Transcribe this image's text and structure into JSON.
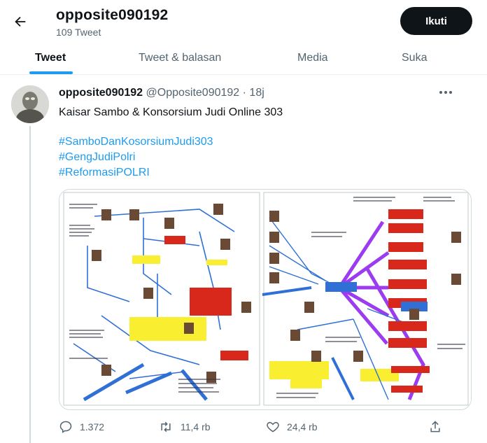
{
  "header": {
    "profile_name": "opposite090192",
    "tweet_count": "109 Tweet",
    "follow_label": "Ikuti"
  },
  "tabs": [
    {
      "label": "Tweet",
      "active": true
    },
    {
      "label": "Tweet & balasan",
      "active": false
    },
    {
      "label": "Media",
      "active": false
    },
    {
      "label": "Suka",
      "active": false
    }
  ],
  "tweet": {
    "author_name": "opposite090192",
    "author_handle": "@Opposite090192",
    "separator": "·",
    "time": "18j",
    "text": "Kaisar Sambo & Konsorsium Judi Online 303",
    "hashtags": [
      "#SamboDanKosorsiumJudi303",
      "#GengJudiPolri",
      "#ReformasiPOLRI"
    ],
    "actions": {
      "replies": "1.372",
      "retweets": "11,4 rb",
      "likes": "24,4 rb"
    }
  },
  "colors": {
    "accent": "#1d9bf0",
    "text_primary": "#0f1419",
    "text_secondary": "#536471",
    "border": "#cfd9de"
  },
  "icons": [
    "back-arrow-icon",
    "more-options-icon",
    "reply-icon",
    "retweet-icon",
    "like-icon",
    "share-icon"
  ]
}
